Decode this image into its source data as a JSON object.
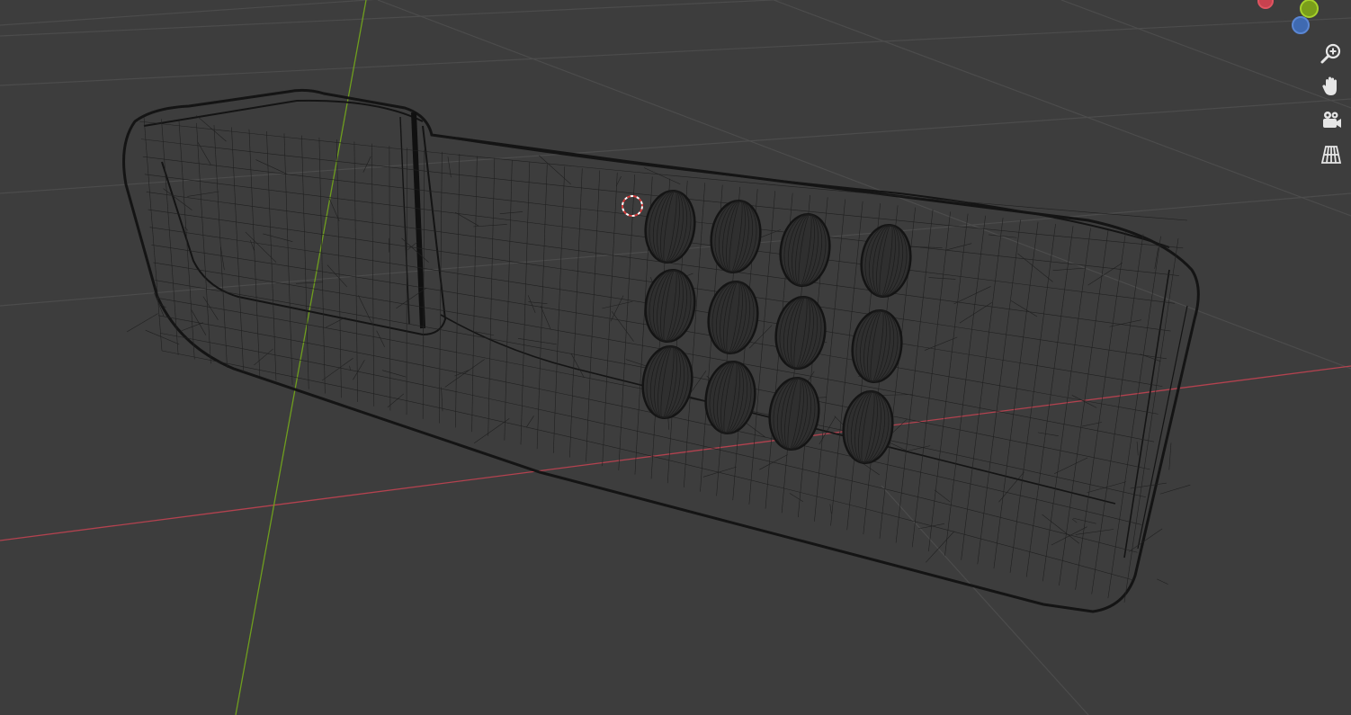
{
  "viewport": {
    "background": "#3d3d3d",
    "grid_color": "#505050",
    "x_axis_color": "#b3424f",
    "y_axis_color": "#6f9e1e",
    "mesh_color": "#121212",
    "display_mode": "wireframe"
  },
  "gizmo": {
    "x_axis_color": "#c8424f",
    "y_axis_color": "#8fbf22",
    "z_axis_color": "#3f6ab1"
  },
  "nav_buttons": [
    {
      "name": "zoom",
      "icon": "zoom-icon"
    },
    {
      "name": "pan",
      "icon": "hand-icon"
    },
    {
      "name": "camera",
      "icon": "camera-icon"
    },
    {
      "name": "perspective-toggle",
      "icon": "grid-icon"
    }
  ],
  "object": {
    "button_rows": 3,
    "button_columns": 4
  }
}
